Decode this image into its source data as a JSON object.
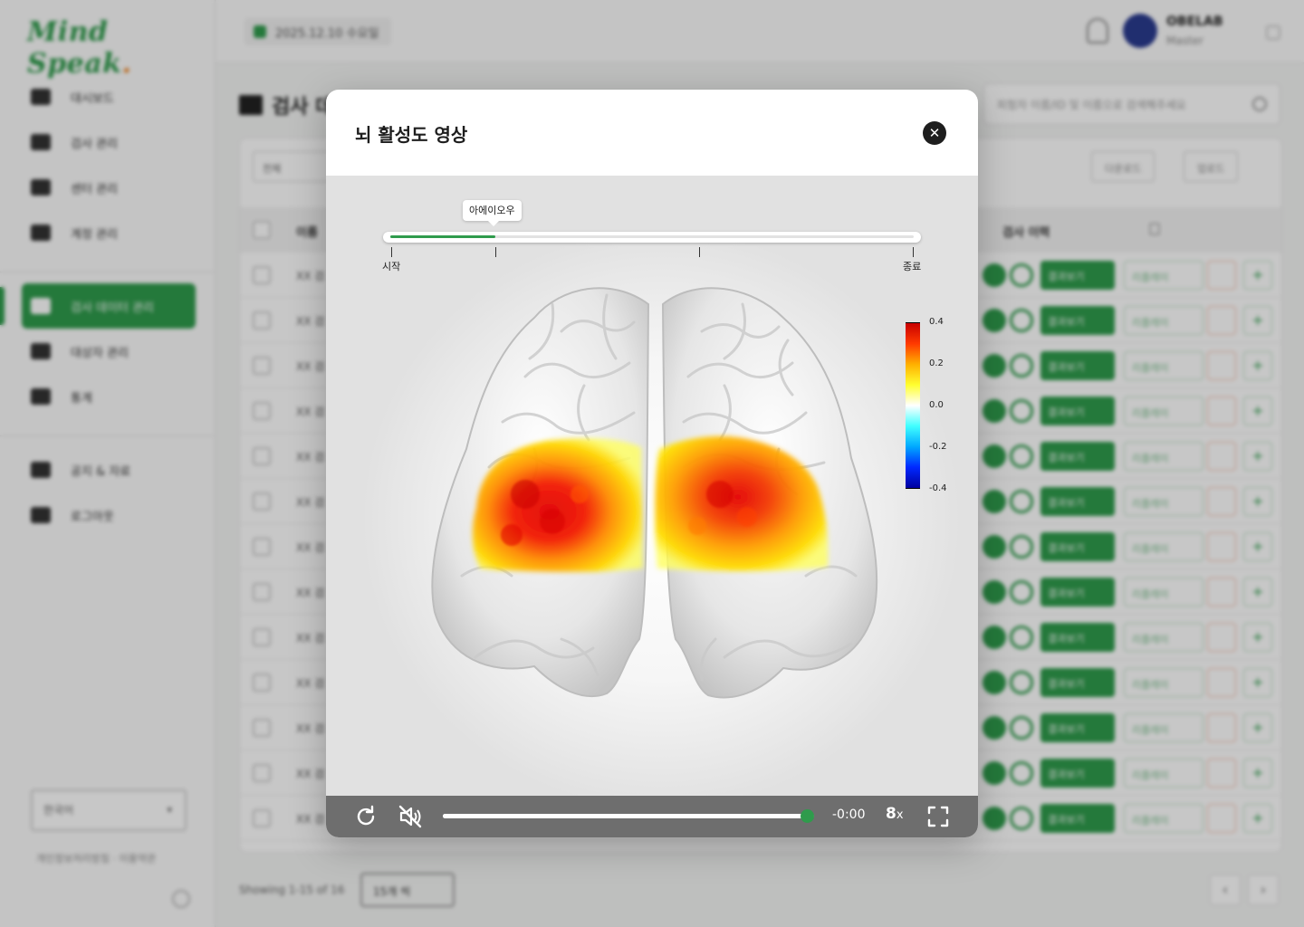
{
  "app": {
    "logo": "Mind Speak",
    "nav": [
      {
        "label": "대시보드",
        "icon": "home-icon"
      },
      {
        "label": "검사 관리",
        "icon": "cap-icon"
      },
      {
        "label": "센터 관리",
        "icon": "document-icon"
      },
      {
        "label": "계정 관리",
        "icon": "users-icon"
      },
      {
        "label": "검사 데이터 관리",
        "icon": "chart-icon",
        "active": true
      },
      {
        "label": "대상자 관리",
        "icon": "id-card-icon"
      },
      {
        "label": "통계",
        "icon": "stats-icon"
      }
    ],
    "nav_secondary": [
      {
        "label": "공지 & 자료",
        "icon": "megaphone-icon"
      },
      {
        "label": "로그아웃",
        "icon": "logout-icon"
      }
    ],
    "language_select": "한국어",
    "footer_links": "개인정보처리방침 · 이용약관",
    "topbar": {
      "date": "2025.12.10 수요일",
      "user_name": "OBELAB",
      "user_role": "Master"
    },
    "page_title": "검사 데이터 관리",
    "search_placeholder": "피험자 이름/ID 및 이름으로 검색해주세요",
    "filter_label": "전체",
    "toolbar": {
      "download": "다운로드",
      "upload": "업로드"
    },
    "table": {
      "headers": [
        "이름",
        "검사 이력"
      ],
      "row_text": "XX 검",
      "row_primary": "결과보기",
      "row_secondary": "리플레이",
      "row_count": 13
    },
    "footer": {
      "showing": "Showing 1-15 of 16",
      "rows_per_page": "15개 씩"
    }
  },
  "modal": {
    "title": "뇌 활성도 영상",
    "timeline": {
      "progress": 0.2,
      "bubble_label": "아에이오우",
      "start_label": "시작",
      "end_label": "종료",
      "marker_positions": [
        0.0,
        0.2,
        0.59,
        1.0
      ]
    },
    "colorbar": {
      "ticks": [
        "0.4",
        "0.2",
        "0.0",
        "-0.2",
        "-0.4"
      ],
      "colors": [
        "#c80000",
        "#ff3a00",
        "#ffb000",
        "#ffff30",
        "#ffffff",
        "#40ffff",
        "#00a8ff",
        "#0028ff",
        "#0000a0"
      ]
    },
    "player": {
      "time": "-0:00",
      "speed_value": "8",
      "speed_unit": "x",
      "progress": 0.98
    }
  }
}
